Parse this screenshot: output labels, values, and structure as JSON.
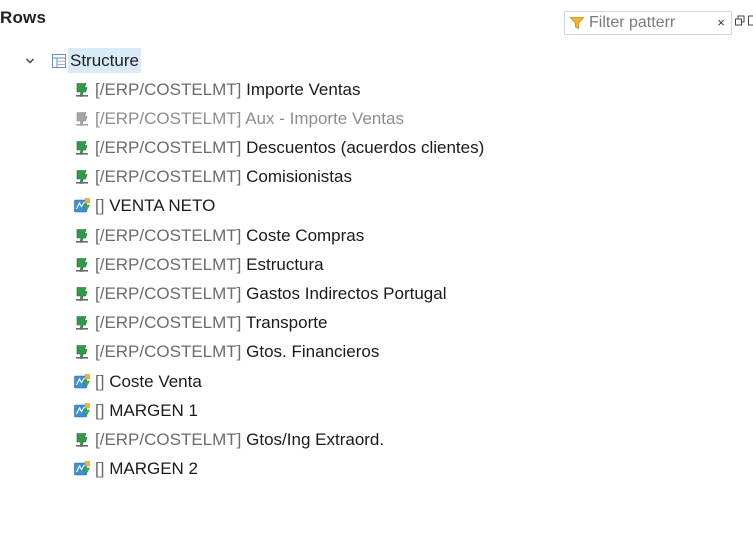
{
  "panel": {
    "title": "Rows",
    "filter": {
      "placeholder": "Filter patterr",
      "value": "",
      "clear_label": "×"
    }
  },
  "tree": {
    "root": {
      "label": "Structure",
      "expanded": true,
      "icon": "structure-icon"
    },
    "items": [
      {
        "prefix": "[/ERP/COSTELMT]",
        "name": "Importe Ventas",
        "icon": "key-figure-icon",
        "enabled": true
      },
      {
        "prefix": "[/ERP/COSTELMT]",
        "name": "Aux - Importe Ventas",
        "icon": "key-figure-icon",
        "enabled": false
      },
      {
        "prefix": "[/ERP/COSTELMT]",
        "name": "Descuentos (acuerdos clientes)",
        "icon": "key-figure-icon",
        "enabled": true
      },
      {
        "prefix": "[/ERP/COSTELMT]",
        "name": "Comisionistas",
        "icon": "key-figure-icon",
        "enabled": true
      },
      {
        "prefix": "[]",
        "name": "VENTA NETO",
        "icon": "formula-icon",
        "enabled": true
      },
      {
        "prefix": "[/ERP/COSTELMT]",
        "name": "Coste Compras",
        "icon": "key-figure-icon",
        "enabled": true
      },
      {
        "prefix": "[/ERP/COSTELMT]",
        "name": "Estructura",
        "icon": "key-figure-icon",
        "enabled": true
      },
      {
        "prefix": "[/ERP/COSTELMT]",
        "name": "Gastos Indirectos Portugal",
        "icon": "key-figure-icon",
        "enabled": true
      },
      {
        "prefix": "[/ERP/COSTELMT]",
        "name": "Transporte",
        "icon": "key-figure-icon",
        "enabled": true
      },
      {
        "prefix": "[/ERP/COSTELMT]",
        "name": "Gtos. Financieros",
        "icon": "key-figure-icon",
        "enabled": true
      },
      {
        "prefix": "[]",
        "name": "Coste Venta",
        "icon": "formula-icon",
        "enabled": true
      },
      {
        "prefix": "[]",
        "name": "MARGEN 1",
        "icon": "formula-icon",
        "enabled": true
      },
      {
        "prefix": "[/ERP/COSTELMT]",
        "name": "Gtos/Ing Extraord.",
        "icon": "key-figure-icon",
        "enabled": true
      },
      {
        "prefix": "[]",
        "name": "MARGEN 2",
        "icon": "formula-icon",
        "enabled": true
      }
    ]
  },
  "colors": {
    "selection": "#daeaf7",
    "filter_funnel": "#f2b62c",
    "key_figure_green": "#2e9a4a",
    "disabled_text": "#8d8d8d"
  }
}
